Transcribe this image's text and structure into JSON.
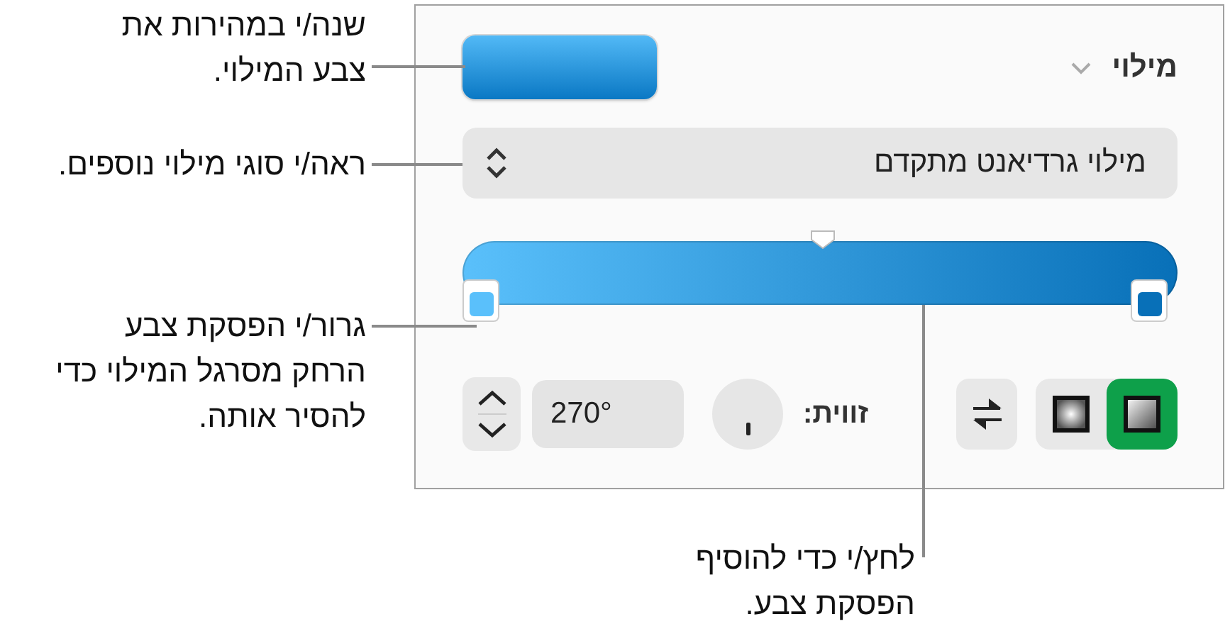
{
  "callouts": [
    {
      "text": "שנה/י במהירות את צבע המילוי."
    },
    {
      "text": "ראה/י סוגי מילוי נוספים."
    },
    {
      "text": "גרור/י הפסקת צבע הרחק מסרגל המילוי כדי להסיר אותה."
    },
    {
      "text": "לחץ/י כדי להוסיף הפסקת צבע."
    }
  ],
  "panel": {
    "section": {
      "title": "מילוי",
      "expanded": true
    },
    "fill_type": {
      "value": "מילוי גרדיאנט מתקדם"
    },
    "gradient": {
      "stops": [
        {
          "color": "#5ac0fb"
        },
        {
          "color": "#0870b8"
        }
      ]
    },
    "angle": {
      "label": "זווית:",
      "value": "270°"
    },
    "gradient_types": [
      {
        "kind": "linear",
        "selected": true
      },
      {
        "kind": "radial",
        "selected": false
      }
    ]
  }
}
